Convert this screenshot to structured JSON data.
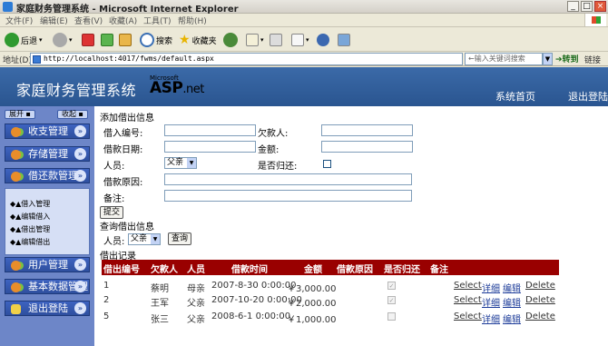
{
  "window": {
    "title": "家庭财务管理系统 - Microsoft Internet Explorer",
    "controls": [
      "_",
      "□",
      "×"
    ]
  },
  "menu": [
    "文件(F)",
    "编辑(E)",
    "查看(V)",
    "收藏(A)",
    "工具(T)",
    "帮助(H)"
  ],
  "toolbar": {
    "back": "后退",
    "search": "搜索",
    "favorites": "收藏夹"
  },
  "address": {
    "label": "地址(D)",
    "url": "http://localhost:4017/fwms/default.aspx",
    "search_placeholder": "←输入关键词搜索",
    "go": "转到",
    "links": "链接"
  },
  "header": {
    "site_title": "家庭财务管理系统",
    "ms_label": "Microsoft",
    "asp_logo": "ASP",
    "asp_suffix": ".net",
    "home": "系统首页",
    "logout": "退出登陆"
  },
  "sidebar": {
    "expand": "展开",
    "collapse": "收起",
    "sections": [
      "收支管理",
      "存储管理",
      "借还款管理",
      "用户管理",
      "基本数据管理",
      "退出登陆"
    ],
    "submenu": [
      "◆▲借入管理",
      "◆▲编辑借入",
      "◆▲借出管理",
      "◆▲编辑借出"
    ]
  },
  "form": {
    "section_title": "添加借出信息",
    "borrow_id_label": "借入编号:",
    "debtor_label": "欠款人:",
    "date_label": "借款日期:",
    "amount_label": "金额:",
    "person_label": "人员:",
    "person_value": "父亲",
    "returned_label": "是否归还:",
    "reason_label": "借款原因:",
    "note_label": "备注:",
    "submit": "提交"
  },
  "query": {
    "title": "查询借出信息",
    "person_label": "人员:",
    "person_value": "父亲",
    "button": "查询"
  },
  "records": {
    "title": "借出记录",
    "columns": [
      "借出编号",
      "欠款人",
      "人员",
      "借款时间",
      "金额",
      "借款原因",
      "是否归还",
      "备注"
    ],
    "rows": [
      {
        "id": "1",
        "debtor": "蔡明",
        "person": "母亲",
        "time": "2007-8-30 0:00:00",
        "amount": "￥3,000.00",
        "returned": true,
        "select": "Select",
        "detail": "详细",
        "edit": "编辑",
        "delete": "Delete"
      },
      {
        "id": "2",
        "debtor": "王军",
        "person": "父亲",
        "time": "2007-10-20 0:00:00",
        "amount": "￥2,000.00",
        "returned": true,
        "select": "Select",
        "detail": "详细",
        "edit": "编辑",
        "delete": "Delete"
      },
      {
        "id": "5",
        "debtor": "张三",
        "person": "父亲",
        "time": "2008-6-1 0:00:00",
        "amount": "￥1,000.00",
        "returned": false,
        "select": "Select",
        "detail": "详细",
        "edit": "编辑",
        "delete": "Delete"
      }
    ]
  }
}
